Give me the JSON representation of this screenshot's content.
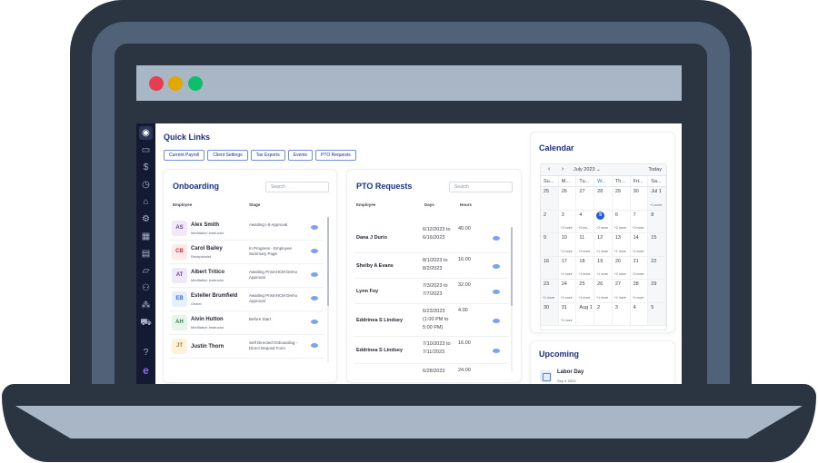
{
  "window": {
    "controls": [
      "close",
      "minimize",
      "maximize"
    ],
    "colors": {
      "close": "#e63d52",
      "minimize": "#e0a800",
      "maximize": "#0dbf6b"
    }
  },
  "sidebar": {
    "items": [
      {
        "icon": "dashboard-icon",
        "glyph": "◉",
        "active": true
      },
      {
        "icon": "payroll-icon",
        "glyph": "▭"
      },
      {
        "icon": "dollar-icon",
        "glyph": "$"
      },
      {
        "icon": "clock-icon",
        "glyph": "◷"
      },
      {
        "icon": "org-icon",
        "glyph": "⌂"
      },
      {
        "icon": "settings-icon",
        "glyph": "⚙"
      },
      {
        "icon": "calendar-icon",
        "glyph": "▦"
      },
      {
        "icon": "id-card-icon",
        "glyph": "▤"
      },
      {
        "icon": "folder-icon",
        "glyph": "▱"
      },
      {
        "icon": "people-icon",
        "glyph": "⚇"
      },
      {
        "icon": "network-icon",
        "glyph": "⁂"
      },
      {
        "icon": "truck-icon",
        "glyph": "⛟"
      },
      {
        "icon": "help-icon",
        "glyph": "?"
      },
      {
        "icon": "brand-logo-icon",
        "glyph": "e"
      }
    ]
  },
  "quick_links": {
    "title": "Quick Links",
    "buttons": [
      "Current Payroll",
      "Client Settings",
      "Tax Exports",
      "Events",
      "PTO Requests"
    ]
  },
  "onboarding": {
    "title": "Onboarding",
    "search_placeholder": "Search",
    "columns": [
      "Employee",
      "Stage"
    ],
    "rows": [
      {
        "initials": "AS",
        "name": "Alex Smith",
        "role": "Meditation Instructor",
        "stage": "Awaiting I-9 Approval",
        "avatar_bg": "#f1e8f8",
        "avatar_fg": "#7b3fa6"
      },
      {
        "initials": "CB",
        "name": "Carol Bailey",
        "role": "Receptionist",
        "stage": "In Progress - Employee Summary Page",
        "avatar_bg": "#fde8ea",
        "avatar_fg": "#d8263f"
      },
      {
        "initials": "AT",
        "name": "Albert Tritico",
        "role": "Meditation Instructor",
        "stage": "Awaiting PrismHCM Demo Approval",
        "avatar_bg": "#efe8f8",
        "avatar_fg": "#6b3fa6"
      },
      {
        "initials": "EB",
        "name": "Esteller Brumfield",
        "role": "Owner",
        "stage": "Awaiting PrismHCM Demo Approval",
        "avatar_bg": "#e6effd",
        "avatar_fg": "#2e6be6"
      },
      {
        "initials": "AH",
        "name": "Alvin Hutton",
        "role": "Meditation Instructor",
        "stage": "Before Start",
        "avatar_bg": "#e6f5ea",
        "avatar_fg": "#2d8a4a"
      },
      {
        "initials": "JT",
        "name": "Justin Thorn",
        "role": "",
        "stage": "Self Directed Onboarding - Direct Deposit Form",
        "avatar_bg": "#fdf3dc",
        "avatar_fg": "#b07d10"
      }
    ]
  },
  "pto": {
    "title": "PTO Requests",
    "search_placeholder": "Search",
    "columns": [
      "Employee",
      "Days",
      "Hours"
    ],
    "rows": [
      {
        "name": "Dana J Durio",
        "days": "6/12/2023 to 6/16/2023",
        "hours": "40.00"
      },
      {
        "name": "Shelby A Evans",
        "days": "8/1/2023 to 8/2/2023",
        "hours": "16.00"
      },
      {
        "name": "Lynn Foy",
        "days": "7/3/2023 to 7/7/2023",
        "hours": "32.00"
      },
      {
        "name": "Eddrinea S Lindsey",
        "days": "6/23/2023 (1:00 PM to 5:00 PM)",
        "hours": "4.00"
      },
      {
        "name": "Eddrinea S Lindsey",
        "days": "7/10/2023 to 7/11/2023",
        "hours": "16.00"
      },
      {
        "name": "",
        "days": "6/28/2023",
        "hours": "24.00"
      }
    ]
  },
  "calendar": {
    "title": "Calendar",
    "month_label": "July 2023",
    "today_label": "Today",
    "weekdays": [
      "Su...",
      "M...",
      "Tu...",
      "W...",
      "Th...",
      "Fri...",
      "Sa..."
    ],
    "current_weekday_index": 3,
    "days": [
      {
        "n": "25",
        "m": ""
      },
      {
        "n": "26",
        "m": ""
      },
      {
        "n": "27",
        "m": ""
      },
      {
        "n": "28",
        "m": ""
      },
      {
        "n": "29",
        "m": ""
      },
      {
        "n": "30",
        "m": ""
      },
      {
        "n": "Jul 1",
        "m": "+1 more"
      },
      {
        "n": "2",
        "m": ""
      },
      {
        "n": "3",
        "m": "+2 more"
      },
      {
        "n": "4",
        "m": "+3 mo..."
      },
      {
        "n": "5",
        "m": "+2 more",
        "today": true
      },
      {
        "n": "6",
        "m": "+2 more"
      },
      {
        "n": "7",
        "m": "+2 more"
      },
      {
        "n": "8",
        "m": ""
      },
      {
        "n": "9",
        "m": ""
      },
      {
        "n": "10",
        "m": "+2 more"
      },
      {
        "n": "11",
        "m": "+2 more"
      },
      {
        "n": "12",
        "m": "+1 more"
      },
      {
        "n": "13",
        "m": "+1 more"
      },
      {
        "n": "14",
        "m": "+1 more"
      },
      {
        "n": "15",
        "m": ""
      },
      {
        "n": "16",
        "m": ""
      },
      {
        "n": "17",
        "m": "+1 more"
      },
      {
        "n": "18",
        "m": "+1 more"
      },
      {
        "n": "19",
        "m": "+1 more"
      },
      {
        "n": "20",
        "m": "+2 more"
      },
      {
        "n": "21",
        "m": "+2 more"
      },
      {
        "n": "22",
        "m": ""
      },
      {
        "n": "23",
        "m": "+1 more"
      },
      {
        "n": "24",
        "m": "+1 more"
      },
      {
        "n": "25",
        "m": "+1 more"
      },
      {
        "n": "26",
        "m": "+1 more"
      },
      {
        "n": "27",
        "m": "+1 more"
      },
      {
        "n": "28",
        "m": "+1 more"
      },
      {
        "n": "29",
        "m": ""
      },
      {
        "n": "30",
        "m": ""
      },
      {
        "n": "31",
        "m": "+1 more"
      },
      {
        "n": "Aug 1",
        "m": ""
      },
      {
        "n": "2",
        "m": ""
      },
      {
        "n": "3",
        "m": ""
      },
      {
        "n": "4",
        "m": ""
      },
      {
        "n": "5",
        "m": ""
      }
    ]
  },
  "upcoming": {
    "title": "Upcoming",
    "items": [
      {
        "name": "Labor Day",
        "date": "Sep 4 2023"
      }
    ]
  }
}
